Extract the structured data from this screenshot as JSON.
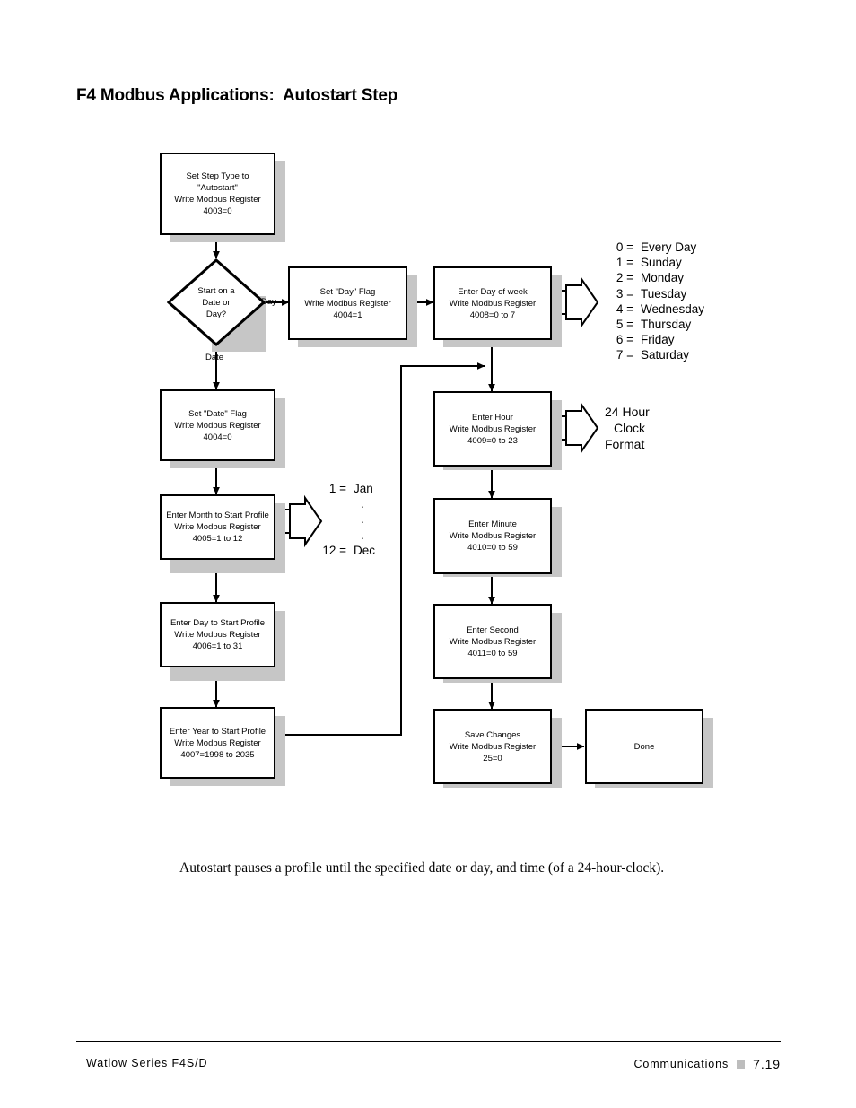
{
  "page": {
    "title": "F4 Modbus Applications:  Autostart Step",
    "caption": "Autostart pauses a profile until the specified date or day, and time (of a 24-hour-clock).",
    "footer_left": "Watlow Series F4S/D",
    "footer_right_label": "Communications",
    "footer_page": "7.19",
    "footer_marker_color": "#bdbdbd"
  },
  "flowchart": {
    "nodes": {
      "set_step_type": {
        "line1": "Set Step Type to",
        "line2": "\"Autostart\"",
        "line3": "Write Modbus Register",
        "line4": "4003=0"
      },
      "decision": {
        "line1": "Start on a",
        "line2": "Date or",
        "line3": "Day?"
      },
      "set_day_flag": {
        "line1": "Set \"Day\" Flag",
        "line2": "Write Modbus Register",
        "line3": "4004=1"
      },
      "enter_day_of_week": {
        "line1": "Enter Day of week",
        "line2": "Write Modbus Register",
        "line3": "4008=0 to 7"
      },
      "set_date_flag": {
        "line1": "Set \"Date\" Flag",
        "line2": "Write Modbus Register",
        "line3": "4004=0"
      },
      "enter_month": {
        "line1": "Enter Month to Start Profile",
        "line2": "Write Modbus Register",
        "line3": "4005=1 to 12"
      },
      "enter_day": {
        "line1": "Enter Day to Start Profile",
        "line2": "Write Modbus Register",
        "line3": "4006=1 to 31"
      },
      "enter_year": {
        "line1": "Enter Year to Start Profile",
        "line2": "Write Modbus Register",
        "line3": "4007=1998 to 2035"
      },
      "enter_hour": {
        "line1": "Enter Hour",
        "line2": "Write Modbus Register",
        "line3": "4009=0 to 23"
      },
      "enter_minute": {
        "line1": "Enter Minute",
        "line2": "Write Modbus Register",
        "line3": "4010=0 to 59"
      },
      "enter_second": {
        "line1": "Enter Second",
        "line2": "Write Modbus Register",
        "line3": "4011=0 to 59"
      },
      "save_changes": {
        "line1": "Save Changes",
        "line2": "Write Modbus Register",
        "line3": "25=0"
      },
      "done": {
        "line1": "Done"
      }
    },
    "edge_labels": {
      "day_branch": "Day",
      "date_branch": "Date"
    },
    "legends": {
      "day_of_week": [
        {
          "key": "0 =",
          "value": "Every Day"
        },
        {
          "key": "1 =",
          "value": "Sunday"
        },
        {
          "key": "2 =",
          "value": "Monday"
        },
        {
          "key": "3 =",
          "value": "Tuesday"
        },
        {
          "key": "4 =",
          "value": "Wednesday"
        },
        {
          "key": "5 =",
          "value": "Thursday"
        },
        {
          "key": "6 =",
          "value": "Friday"
        },
        {
          "key": "7 =",
          "value": "Saturday"
        }
      ],
      "hour_format": {
        "line1": "24 Hour",
        "line2": "Clock",
        "line3": "Format"
      },
      "month": {
        "first_key": "1 =",
        "first_value": "Jan",
        "ellipsis": ".",
        "last_key": "12 =",
        "last_value": "Dec"
      }
    }
  }
}
